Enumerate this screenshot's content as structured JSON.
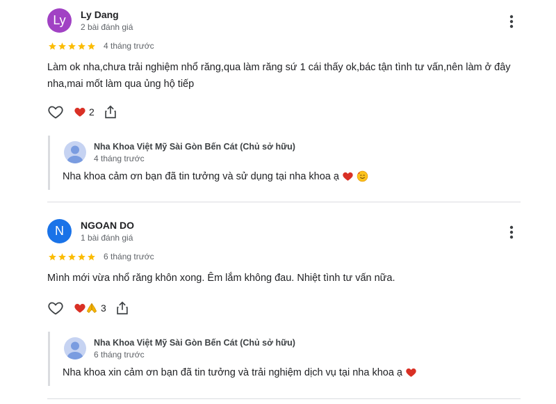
{
  "reviews": [
    {
      "avatar_letter": "Ly",
      "avatar_color": "#a142c4",
      "author": "Ly Dang",
      "author_meta": "2 bài đánh giá",
      "rating": 5,
      "date": "4 tháng trước",
      "text": "Làm ok nha,chưa trải nghiệm nhổ răng,qua làm răng sứ 1 cái thấy ok,bác tận tình tư vấn,nên làm ở đây nha,mai mốt làm qua ủng hộ tiếp",
      "reactions": [
        "heart-emoji"
      ],
      "reaction_count": "2",
      "owner_reply": {
        "name": "Nha Khoa Việt Mỹ Sài Gòn Bến Cát (Chủ sở hữu)",
        "date": "4 tháng trước",
        "text": "Nha khoa cảm ơn bạn đã tin tưởng và sử dụng tại nha khoa ạ",
        "emojis": [
          "heart-emoji",
          "smiling-face-with-hearts-emoji"
        ]
      }
    },
    {
      "avatar_letter": "N",
      "avatar_color": "#1a73e8",
      "author": "NGOAN DO",
      "author_meta": "1 bài đánh giá",
      "rating": 5,
      "date": "6 tháng trước",
      "text": "Mình mới vừa nhổ răng khôn xong. Êm lắm không đau. Nhiệt tình tư vấn nữa.",
      "reactions": [
        "heart-emoji",
        "folded-hands-emoji"
      ],
      "reaction_count": "3",
      "owner_reply": {
        "name": "Nha Khoa Việt Mỹ Sài Gòn Bến Cát (Chủ sở hữu)",
        "date": "6 tháng trước",
        "text": "Nha khoa xin cảm ơn bạn đã tin tưởng và trải nghiệm dịch vụ tại nha khoa ạ",
        "emojis": [
          "heart-emoji"
        ]
      }
    }
  ],
  "colors": {
    "star": "#fbbc04",
    "heart": "#d93025",
    "text_secondary": "#5f6368",
    "divider": "#dadce0"
  }
}
